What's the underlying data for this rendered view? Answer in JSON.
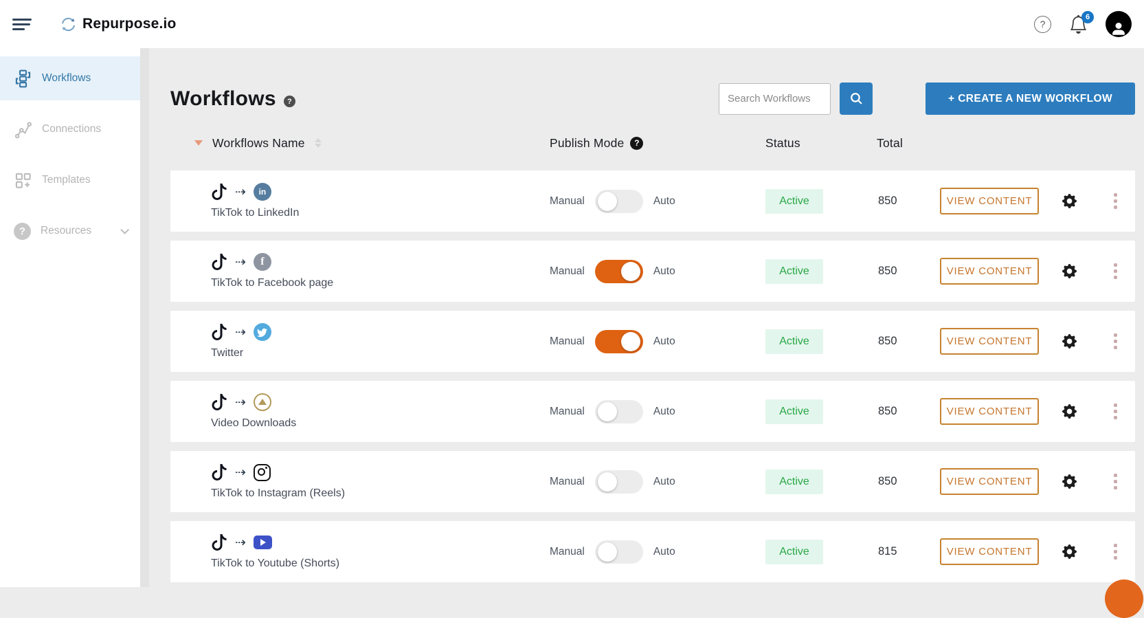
{
  "topbar": {
    "brand": "Repurpose.io",
    "notification_count": "6"
  },
  "sidebar": {
    "items": [
      {
        "label": "Workflows",
        "active": true
      },
      {
        "label": "Connections",
        "active": false
      },
      {
        "label": "Templates",
        "active": false
      },
      {
        "label": "Resources",
        "active": false,
        "has_chevron": true
      }
    ]
  },
  "main": {
    "page_title": "Workflows",
    "search_placeholder": "Search Workflows",
    "create_button_label": "+ CREATE A NEW WORKFLOW",
    "table": {
      "header": {
        "name": "Workflows Name",
        "publish_mode": "Publish Mode",
        "status": "Status",
        "total": "Total"
      },
      "publish_labels": {
        "manual": "Manual",
        "auto": "Auto"
      },
      "rows": [
        {
          "name": "TikTok to LinkedIn",
          "source_icon": "tiktok",
          "dest_icon": "linkedin",
          "publish_auto": false,
          "status": "Active",
          "total": "850",
          "action_label": "VIEW CONTENT"
        },
        {
          "name": "TikTok to Facebook page",
          "source_icon": "tiktok",
          "dest_icon": "facebook",
          "publish_auto": true,
          "status": "Active",
          "total": "850",
          "action_label": "VIEW CONTENT"
        },
        {
          "name": "Twitter",
          "source_icon": "tiktok",
          "dest_icon": "twitter",
          "publish_auto": true,
          "status": "Active",
          "total": "850",
          "action_label": "VIEW CONTENT"
        },
        {
          "name": "Video Downloads",
          "source_icon": "tiktok",
          "dest_icon": "video",
          "publish_auto": false,
          "status": "Active",
          "total": "850",
          "action_label": "VIEW CONTENT"
        },
        {
          "name": "TikTok to Instagram (Reels)",
          "source_icon": "tiktok",
          "dest_icon": "instagram",
          "publish_auto": false,
          "status": "Active",
          "total": "850",
          "action_label": "VIEW CONTENT"
        },
        {
          "name": "TikTok to Youtube (Shorts)",
          "source_icon": "tiktok",
          "dest_icon": "youtube",
          "publish_auto": false,
          "status": "Active",
          "total": "815",
          "action_label": "VIEW CONTENT"
        }
      ]
    }
  },
  "colors": {
    "accent_blue": "#2D7DBE",
    "toggle_on_orange": "#DE6212",
    "active_badge_bg": "#E3F6ED",
    "active_badge_text": "#28A745",
    "view_content_orange": "#C5752C",
    "sidebar_active_text": "#3279A9",
    "sidebar_active_bg": "#E7F1F9",
    "page_background": "#ECECEC",
    "notification_badge": "#1876C6",
    "chat_fab_orange": "#E2661C"
  }
}
